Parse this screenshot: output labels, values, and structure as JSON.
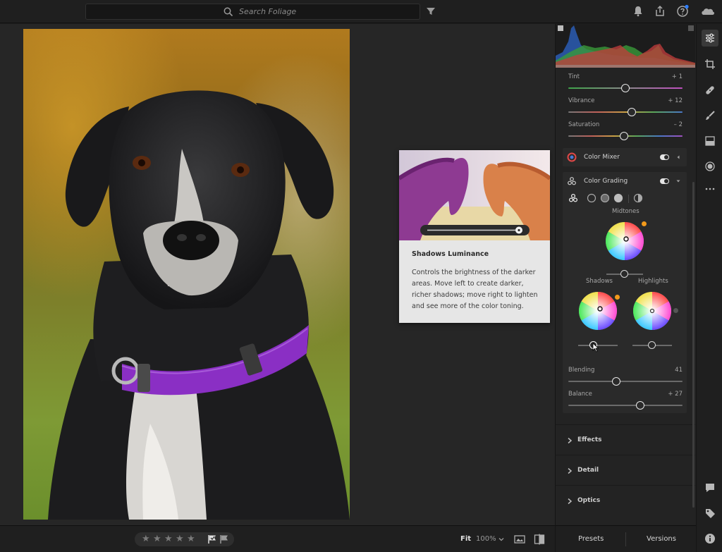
{
  "search": {
    "placeholder": "Search Foliage"
  },
  "icons": {
    "search": "search-icon",
    "filter": "filter-icon",
    "bell": "bell-icon",
    "share": "share-icon",
    "help": "help-icon",
    "cloud": "cloud-icon",
    "edit": "edit-sliders-icon",
    "crop": "crop-icon",
    "heal": "healing-icon",
    "brush": "brush-icon",
    "gradient": "linear-gradient-icon",
    "radial": "radial-gradient-icon",
    "more": "more-icon",
    "comment": "comment-icon",
    "keyword": "keyword-tag-icon",
    "info": "info-icon"
  },
  "sliders": {
    "tint": {
      "label": "Tint",
      "value": "+ 1",
      "position": 0.5
    },
    "vibrance": {
      "label": "Vibrance",
      "value": "+ 12",
      "position": 0.56
    },
    "saturation": {
      "label": "Saturation",
      "value": "– 2",
      "position": 0.49
    }
  },
  "color_mixer": {
    "title": "Color Mixer",
    "enabled": true
  },
  "color_grading": {
    "title": "Color Grading",
    "enabled": true,
    "midtones_label": "Midtones",
    "shadows_label": "Shadows",
    "highlights_label": "Highlights",
    "blending": {
      "label": "Blending",
      "value": "41",
      "position": 0.41
    },
    "balance": {
      "label": "Balance",
      "value": "+ 27",
      "position": 0.63
    }
  },
  "sections": [
    {
      "label": "Effects"
    },
    {
      "label": "Detail"
    },
    {
      "label": "Optics"
    }
  ],
  "tooltip": {
    "title": "Shadows Luminance",
    "body": "Controls the brightness of the darker areas. Move left to create darker, richer shadows; move right to lighten and see more of the color toning."
  },
  "bottom": {
    "rating_stars": [
      "★",
      "★",
      "★",
      "★",
      "★"
    ],
    "fit_label": "Fit",
    "zoom_label": "100%"
  },
  "panel_tabs": {
    "presets": "Presets",
    "versions": "Versions"
  },
  "colors": {
    "accent_orange": "#f29a1b",
    "notification_blue": "#2f7fff",
    "collar_purple": "#8a2fc4"
  }
}
